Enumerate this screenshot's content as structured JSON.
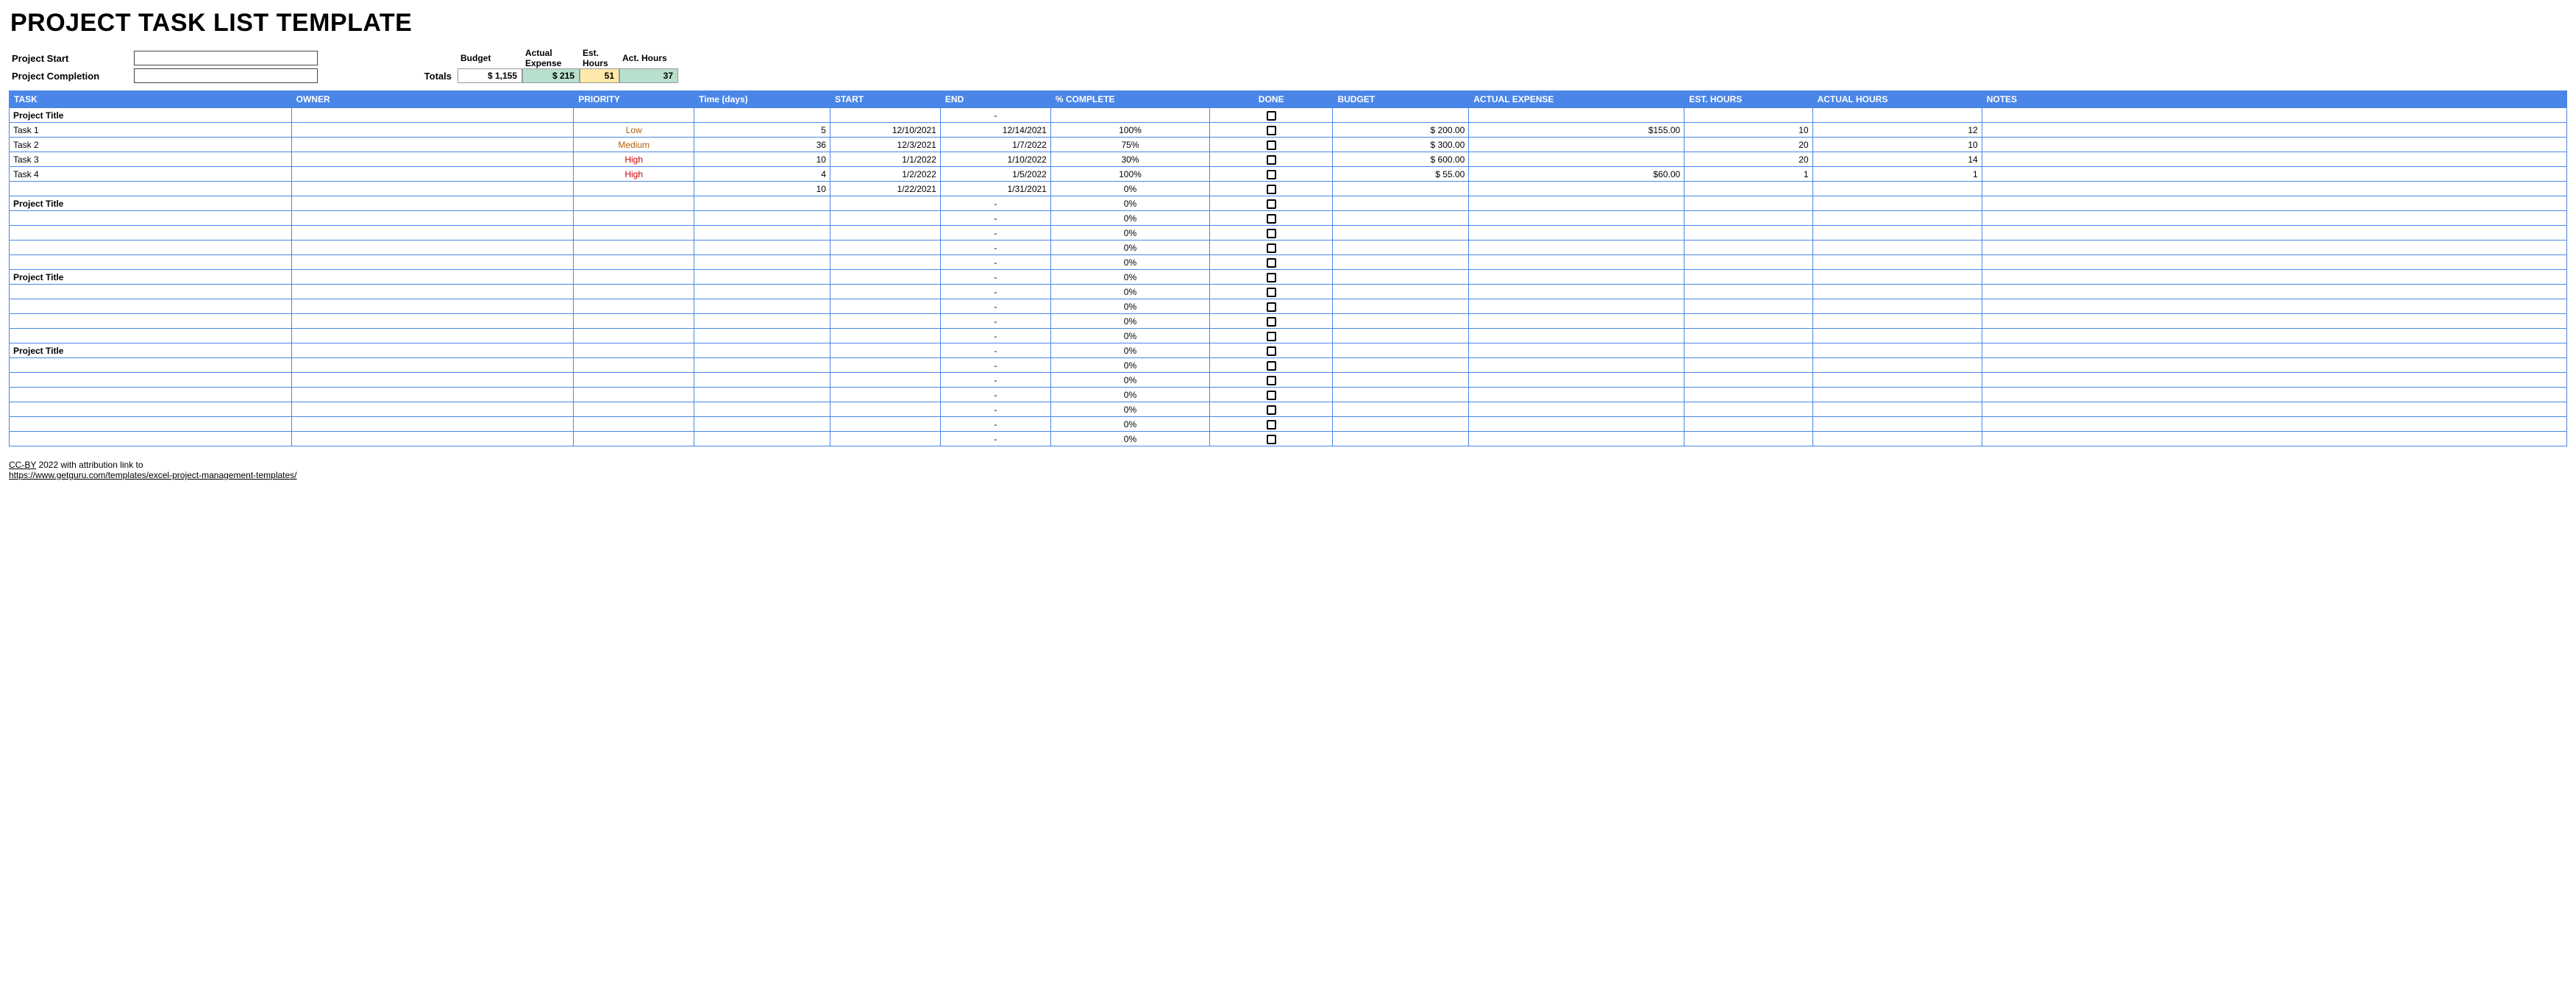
{
  "title": "PROJECT TASK LIST TEMPLATE",
  "meta": {
    "project_start_label": "Project Start",
    "project_start_value": "",
    "project_completion_label": "Project Completion",
    "project_completion_value": "",
    "totals_label": "Totals",
    "budget_header": "Budget",
    "actual_expense_header": "Actual Expense",
    "est_hours_header": "Est. Hours",
    "act_hours_header": "Act. Hours",
    "budget_total": "$    1,155",
    "actual_expense_total": "$             215",
    "est_hours_total": "51",
    "act_hours_total": "37"
  },
  "columns": {
    "task": "TASK",
    "owner": "OWNER",
    "priority": "PRIORITY",
    "time": "Time (days)",
    "start": "START",
    "end": "END",
    "complete": "% COMPLETE",
    "done": "DONE",
    "budget": "BUDGET",
    "actual_expense": "ACTUAL EXPENSE",
    "est_hours": "EST. HOURS",
    "actual_hours": "ACTUAL HOURS",
    "notes": "NOTES"
  },
  "rows": [
    {
      "type": "section",
      "task": "Project Title",
      "end": "-"
    },
    {
      "type": "task",
      "task": "Task 1",
      "priority": "Low",
      "priority_class": "low",
      "time": "5",
      "start": "12/10/2021",
      "end": "12/14/2021",
      "complete": "100%",
      "budget": "$    200.00",
      "actual_expense": "$155.00",
      "est_hours": "10",
      "actual_hours": "12"
    },
    {
      "type": "task",
      "task": "Task 2",
      "priority": "Medium",
      "priority_class": "med",
      "time": "36",
      "start": "12/3/2021",
      "end": "1/7/2022",
      "complete": "75%",
      "budget": "$    300.00",
      "est_hours": "20",
      "actual_hours": "10"
    },
    {
      "type": "task",
      "task": "Task 3",
      "priority": "High",
      "priority_class": "high",
      "time": "10",
      "start": "1/1/2022",
      "end": "1/10/2022",
      "complete": "30%",
      "budget": "$    600.00",
      "est_hours": "20",
      "actual_hours": "14"
    },
    {
      "type": "task",
      "task": "Task 4",
      "priority": "High",
      "priority_class": "high",
      "time": "4",
      "start": "1/2/2022",
      "end": "1/5/2022",
      "complete": "100%",
      "budget": "$      55.00",
      "actual_expense": "$60.00",
      "est_hours": "1",
      "actual_hours": "1"
    },
    {
      "type": "task",
      "task": "",
      "time": "10",
      "start": "1/22/2021",
      "end": "1/31/2021",
      "complete": "0%"
    },
    {
      "type": "section",
      "task": "Project Title",
      "end": "-",
      "complete": "0%"
    },
    {
      "type": "blank",
      "end": "-",
      "complete": "0%"
    },
    {
      "type": "blank",
      "end": "-",
      "complete": "0%"
    },
    {
      "type": "blank",
      "end": "-",
      "complete": "0%"
    },
    {
      "type": "blank",
      "end": "-",
      "complete": "0%"
    },
    {
      "type": "section",
      "task": "Project Title",
      "end": "-",
      "complete": "0%"
    },
    {
      "type": "blank",
      "end": "-",
      "complete": "0%"
    },
    {
      "type": "blank",
      "end": "-",
      "complete": "0%"
    },
    {
      "type": "blank",
      "end": "-",
      "complete": "0%"
    },
    {
      "type": "blank",
      "end": "-",
      "complete": "0%"
    },
    {
      "type": "section",
      "task": "Project Title",
      "end": "-",
      "complete": "0%"
    },
    {
      "type": "blank",
      "end": "-",
      "complete": "0%"
    },
    {
      "type": "blank",
      "end": "-",
      "complete": "0%"
    },
    {
      "type": "blank",
      "end": "-",
      "complete": "0%"
    },
    {
      "type": "blank",
      "end": "-",
      "complete": "0%"
    },
    {
      "type": "blank",
      "end": "-",
      "complete": "0%"
    },
    {
      "type": "blank",
      "end": "-",
      "complete": "0%"
    }
  ],
  "footer": {
    "line1_prefix": "CC-BY",
    "line1_rest": " 2022 with attribution link to",
    "line2_link": "https://www.getguru.com/templates/excel-project-management-templates/"
  }
}
